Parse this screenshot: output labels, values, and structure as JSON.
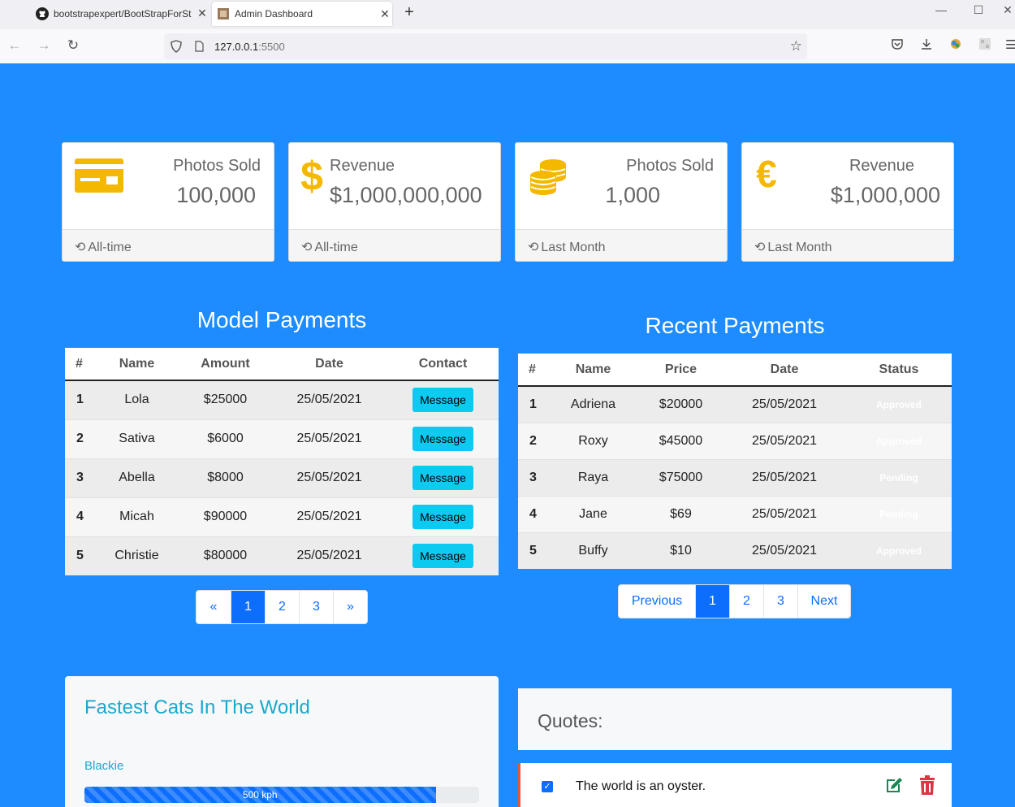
{
  "browser": {
    "tabs": [
      {
        "title": "bootstrapexpert/BootStrapForSt",
        "icon": "github-icon"
      },
      {
        "title": "Admin Dashboard",
        "icon": "page-favicon"
      }
    ],
    "url_host": "127.0.0.1",
    "url_port": ":5500"
  },
  "stats": [
    {
      "label": "Photos Sold",
      "value": "100,000",
      "footer": "All-time",
      "icon": "credit-card-icon"
    },
    {
      "label": "Revenue",
      "value": "$1,000,000,000",
      "footer": "All-time",
      "icon": "dollar-icon"
    },
    {
      "label": "Photos Sold",
      "value": "1,000",
      "footer": "Last Month",
      "icon": "coins-icon"
    },
    {
      "label": "Revenue",
      "value": "$1,000,000",
      "footer": "Last Month",
      "icon": "euro-icon"
    }
  ],
  "model_payments": {
    "title": "Model Payments",
    "headers": [
      "#",
      "Name",
      "Amount",
      "Date",
      "Contact"
    ],
    "rows": [
      {
        "n": "1",
        "name": "Lola",
        "amount": "$25000",
        "date": "25/05/2021",
        "action": "Message"
      },
      {
        "n": "2",
        "name": "Sativa",
        "amount": "$6000",
        "date": "25/05/2021",
        "action": "Message"
      },
      {
        "n": "3",
        "name": "Abella",
        "amount": "$8000",
        "date": "25/05/2021",
        "action": "Message"
      },
      {
        "n": "4",
        "name": "Micah",
        "amount": "$90000",
        "date": "25/05/2021",
        "action": "Message"
      },
      {
        "n": "5",
        "name": "Christie",
        "amount": "$80000",
        "date": "25/05/2021",
        "action": "Message"
      }
    ],
    "pagination": [
      "«",
      "1",
      "2",
      "3",
      "»"
    ],
    "active_page": "1"
  },
  "recent_payments": {
    "title": "Recent Payments",
    "headers": [
      "#",
      "Name",
      "Price",
      "Date",
      "Status"
    ],
    "rows": [
      {
        "n": "1",
        "name": "Adriena",
        "price": "$20000",
        "date": "25/05/2021",
        "status": "Approved"
      },
      {
        "n": "2",
        "name": "Roxy",
        "price": "$45000",
        "date": "25/05/2021",
        "status": "Approved"
      },
      {
        "n": "3",
        "name": "Raya",
        "price": "$75000",
        "date": "25/05/2021",
        "status": "Pending"
      },
      {
        "n": "4",
        "name": "Jane",
        "price": "$69",
        "date": "25/05/2021",
        "status": "Pending"
      },
      {
        "n": "5",
        "name": "Buffy",
        "price": "$10",
        "date": "25/05/2021",
        "status": "Approved"
      }
    ],
    "pagination": [
      "Previous",
      "1",
      "2",
      "3",
      "Next"
    ],
    "active_page": "1"
  },
  "cats": {
    "title": "Fastest Cats In The World",
    "items": [
      {
        "name": "Blackie",
        "speed": "500 kph",
        "progress": 0.89
      }
    ]
  },
  "quotes": {
    "title": "Quotes:",
    "items": [
      {
        "text": "The world is an oyster.",
        "checked": true
      }
    ]
  },
  "colors": {
    "page_bg": "#1e8cff",
    "icon_gold": "#f5b800",
    "primary": "#0d6efd",
    "info": "#0dcaf0",
    "edit_green": "#198754",
    "delete_red": "#dc3545"
  }
}
